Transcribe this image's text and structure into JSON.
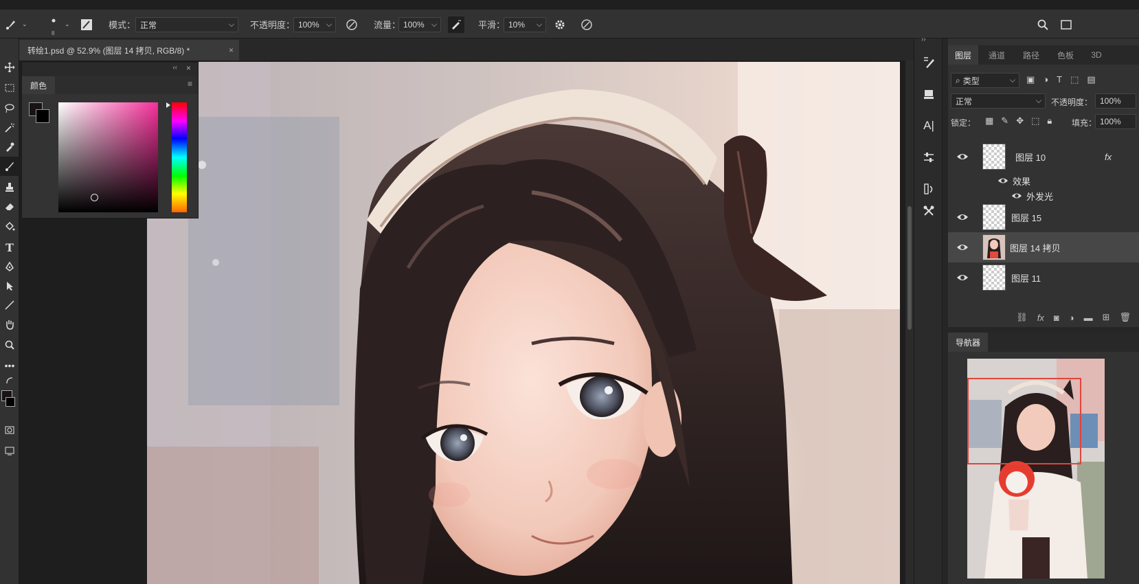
{
  "document": {
    "tab_title": "转绘1.psd @ 52.9% (图层 14 拷贝, RGB/8) *",
    "close_glyph": "×"
  },
  "options_bar": {
    "brush_size": "8",
    "mode_label": "模式：",
    "mode_value": "正常",
    "opacity_label": "不透明度：",
    "opacity_value": "100%",
    "flow_label": "流量：",
    "flow_value": "100%",
    "smoothing_label": "平滑：",
    "smoothing_value": "10%"
  },
  "color_panel": {
    "title": "颜色",
    "foreground_color": "#1a1214",
    "background_color": "#000000",
    "hue_color": "#f7309a"
  },
  "layers_panel": {
    "tabs": [
      "图层",
      "通道",
      "路径",
      "色板",
      "3D"
    ],
    "active_tab": 0,
    "filter_value": "类型",
    "blend_mode": "正常",
    "opacity_label": "不透明度：",
    "opacity_value": "100%",
    "lock_label": "锁定：",
    "fill_label": "填充：",
    "fill_value": "100%",
    "layers": [
      {
        "name": "图层 10",
        "fx": "fx",
        "selected": false
      },
      {
        "name": "图层 15",
        "selected": false
      },
      {
        "name": "图层 14 拷贝",
        "selected": true
      },
      {
        "name": "图层 11",
        "selected": false
      }
    ],
    "effects_label": "效果",
    "outer_glow_label": "外发光",
    "bottom_fx": "fx"
  },
  "navigator": {
    "title": "导航器"
  },
  "accent_colors": {
    "navigator_rect": "#e0453a",
    "panel_bg": "#323232"
  }
}
